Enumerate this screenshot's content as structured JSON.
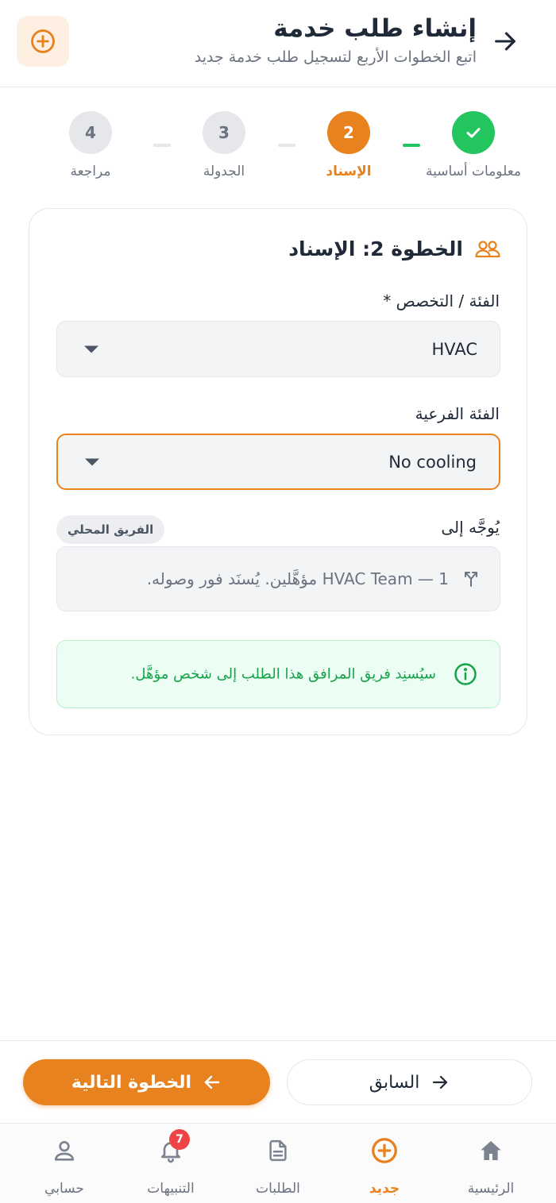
{
  "header": {
    "title": "إنشاء طلب خدمة",
    "subtitle": "اتبع الخطوات الأربع لتسجيل طلب خدمة جديد"
  },
  "stepper": {
    "steps": [
      {
        "number": "1",
        "label": "معلومات أساسية",
        "state": "done"
      },
      {
        "number": "2",
        "label": "الإسناد",
        "state": "active"
      },
      {
        "number": "3",
        "label": "الجدولة",
        "state": "pending"
      },
      {
        "number": "4",
        "label": "مراجعة",
        "state": "pending"
      }
    ]
  },
  "card": {
    "title": "الخطوة 2: الإسناد",
    "category": {
      "label": "الفئة / التخصص *",
      "value": "HVAC"
    },
    "subcategory": {
      "label": "الفئة الفرعية",
      "value": "No cooling"
    },
    "route": {
      "label": "يُوجَّه إلى",
      "badge": "الفريق المحلي",
      "text": "HVAC Team — 1 مؤهَّلين. يُسنَد فور وصوله."
    },
    "info": {
      "text": "سيُسنِد فريق المرافق هذا الطلب إلى شخص مؤهَّل."
    }
  },
  "actions": {
    "prev_label": "السابق",
    "next_label": "الخطوة التالية"
  },
  "nav": {
    "items": [
      {
        "label": "الرئيسية",
        "icon": "home-icon"
      },
      {
        "label": "جديد",
        "icon": "plus-circle-icon",
        "active": true
      },
      {
        "label": "الطلبات",
        "icon": "document-icon"
      },
      {
        "label": "التنبيهات",
        "icon": "bell-icon",
        "badge": "7"
      },
      {
        "label": "حسابي",
        "icon": "user-icon"
      }
    ]
  },
  "colors": {
    "accent": "#e8821f",
    "success": "#22c55e",
    "danger": "#ef4444"
  }
}
